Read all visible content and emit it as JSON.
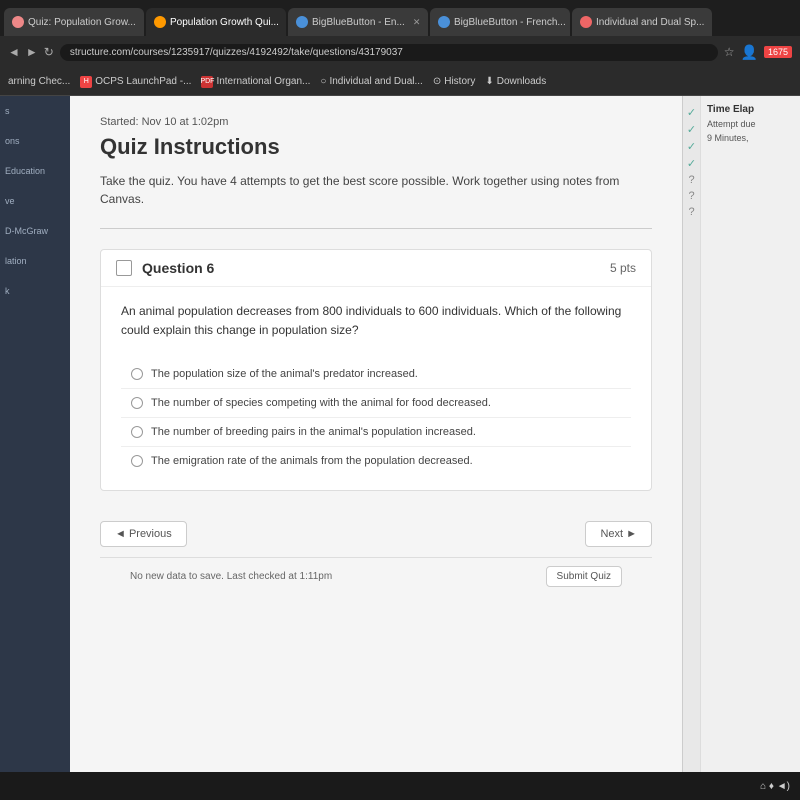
{
  "browser": {
    "tabs": [
      {
        "label": "Quiz: Population Grow...",
        "active": false,
        "icon_color": "#e88"
      },
      {
        "label": "Population Growth Qui...",
        "active": true,
        "icon_color": "#f90"
      },
      {
        "label": "BigBlueButton - En...",
        "active": false,
        "icon_color": "#4a90d9"
      },
      {
        "label": "BigBlueButton - French...",
        "active": false,
        "icon_color": "#4a90d9"
      },
      {
        "label": "Individual and Dual Sp...",
        "active": false,
        "icon_color": "#e66"
      }
    ],
    "address": "structure.com/courses/1235917/quizzes/4192492/take/questions/43179037",
    "bookmarks": [
      {
        "label": "arning Chec...",
        "icon": ""
      },
      {
        "label": "OCPS LaunchPad -...",
        "icon": "H"
      },
      {
        "label": "International Organ...",
        "icon": "PDF"
      },
      {
        "label": "Individual and Dual...",
        "icon": ""
      },
      {
        "label": "History",
        "icon": ""
      },
      {
        "label": "Downloads",
        "icon": ""
      }
    ]
  },
  "sidebar": {
    "items": [
      {
        "label": "s"
      },
      {
        "label": "ons"
      },
      {
        "label": "Education"
      },
      {
        "label": "ve"
      },
      {
        "label": "D-McGraw"
      },
      {
        "label": "lation"
      },
      {
        "label": "k"
      }
    ]
  },
  "quiz": {
    "started": "Started: Nov 10 at 1:02pm",
    "instructions_title": "Quiz Instructions",
    "instructions_text": "Take the quiz.  You have 4 attempts to get the best score possible.  Work together using notes from Canvas.",
    "question": {
      "number": "Question 6",
      "points": "5 pts",
      "text": "An animal population decreases from 800 individuals to 600 individuals. Which of the following could explain this change in population size?",
      "options": [
        {
          "id": "a",
          "text": "The population size of the animal's predator increased."
        },
        {
          "id": "b",
          "text": "The number of species competing with the animal for food decreased."
        },
        {
          "id": "c",
          "text": "The number of breeding pairs in the animal's population increased."
        },
        {
          "id": "d",
          "text": "The emigration rate of the animals from the population decreased."
        }
      ]
    },
    "nav": {
      "previous": "◄ Previous",
      "next": "Next ►"
    },
    "footer": {
      "status": "No new data to save. Last checked at 1:11pm",
      "submit": "Submit Quiz"
    }
  },
  "right_panel": {
    "title": "Time Elap",
    "attempt": "Attempt due",
    "time": "9 Minutes,"
  },
  "taskbar": {
    "time": "⌂ ♦ ◄)"
  }
}
